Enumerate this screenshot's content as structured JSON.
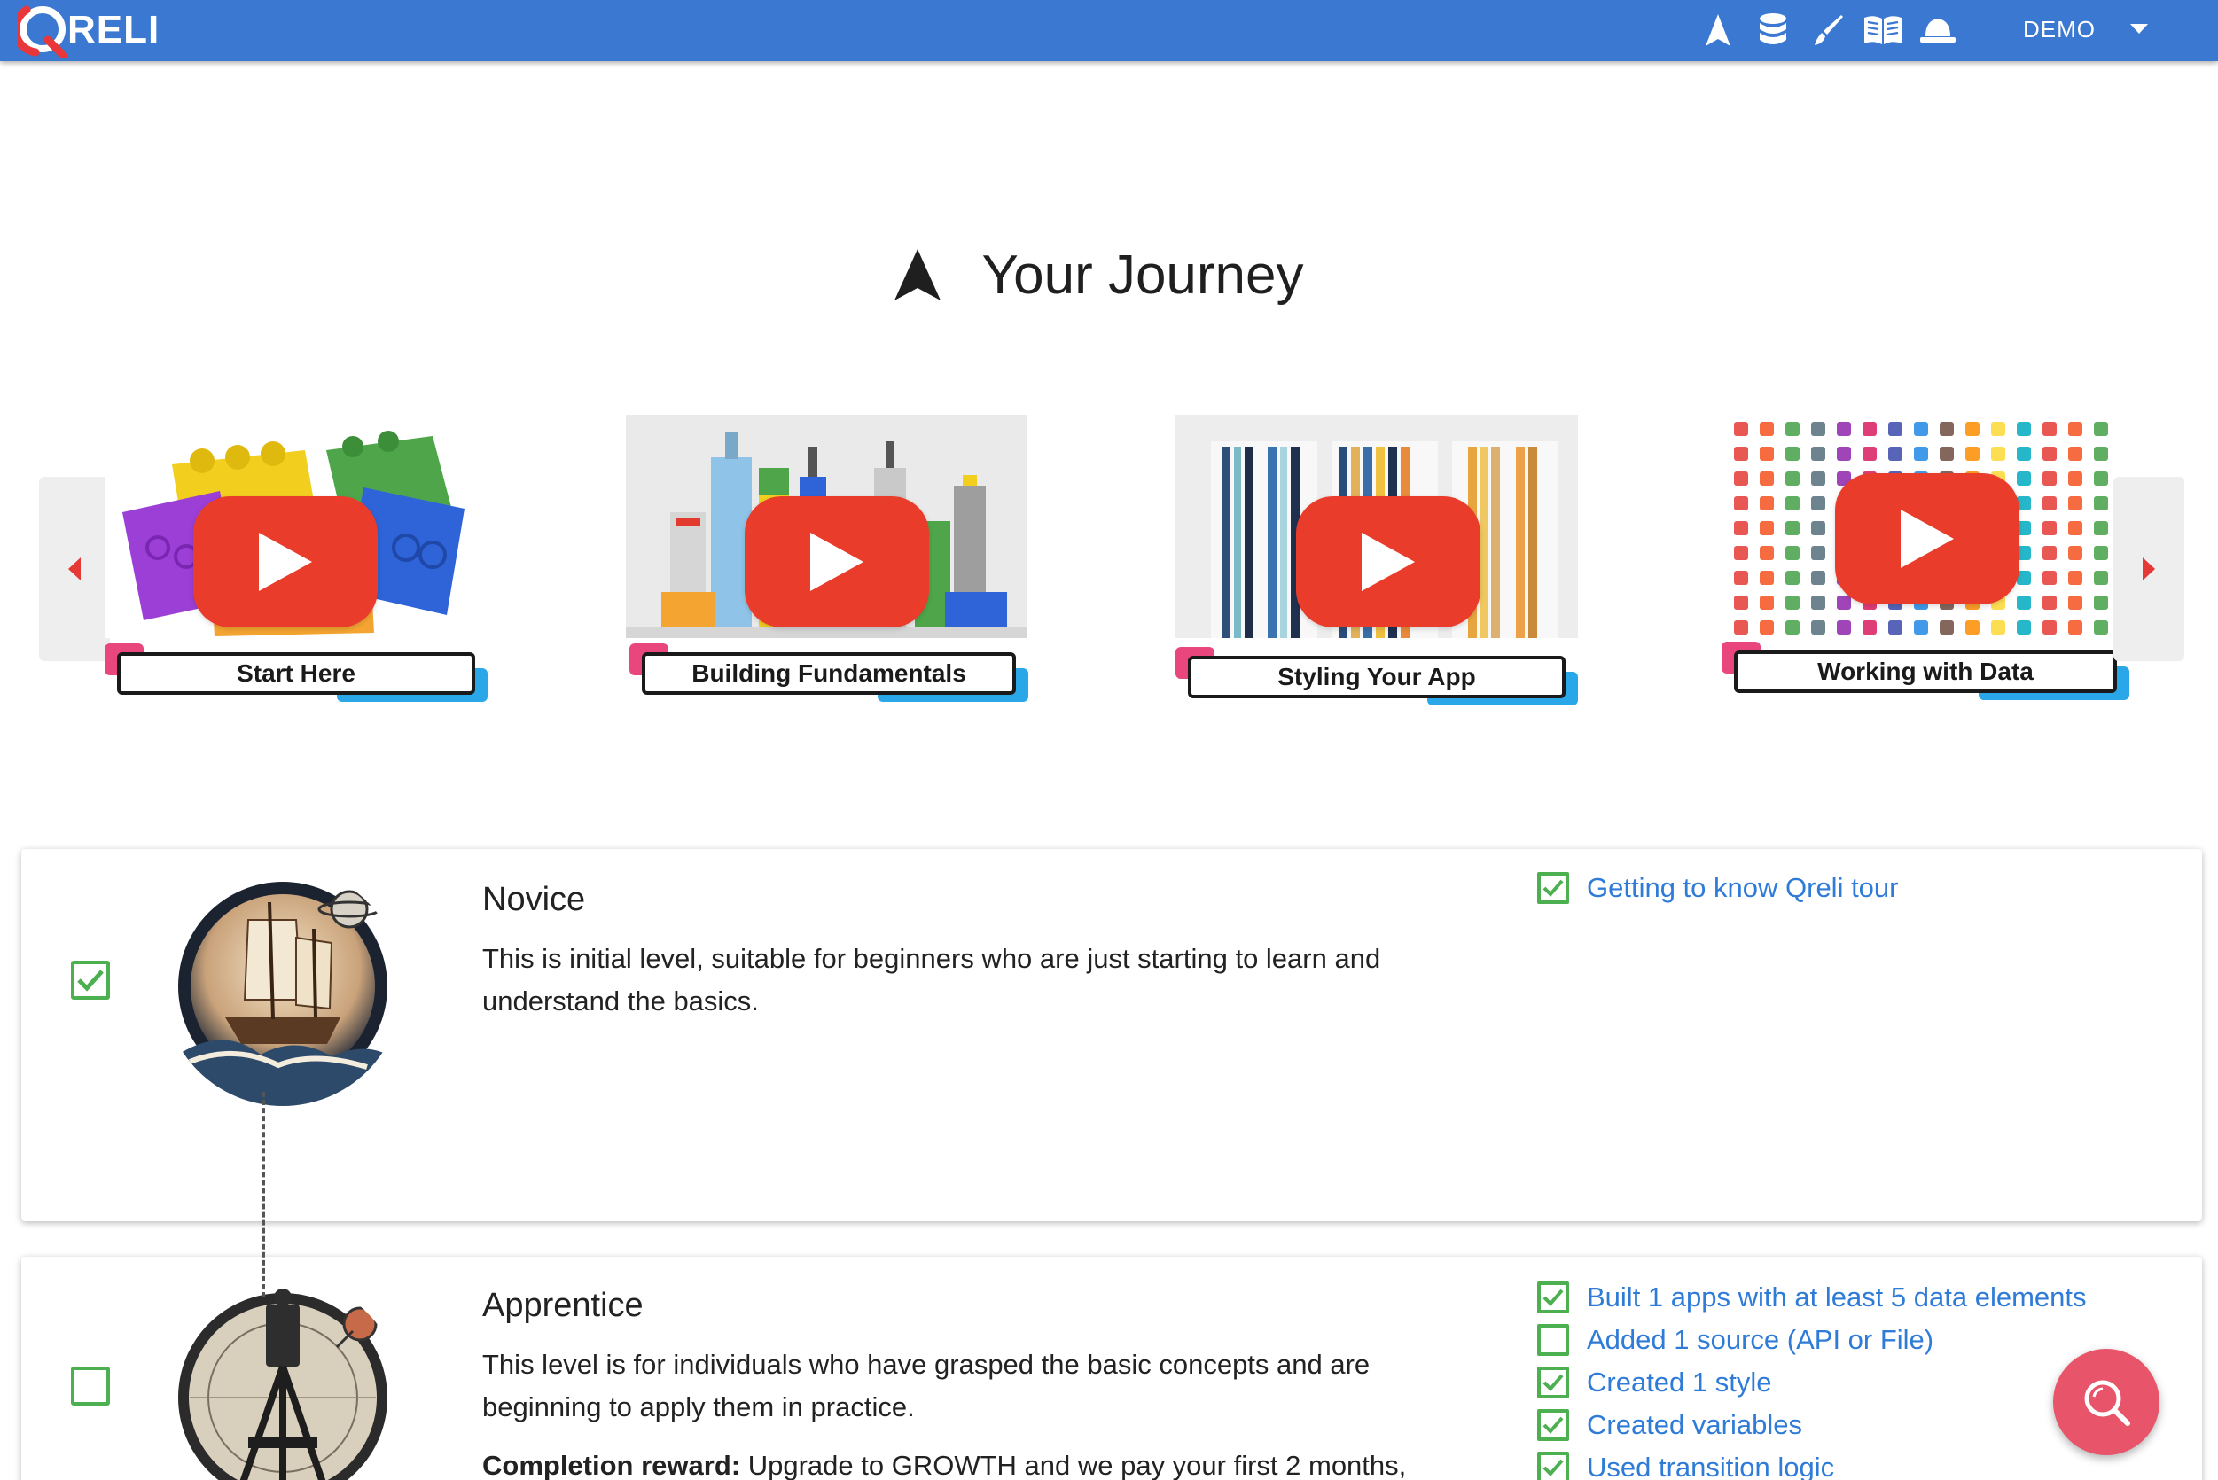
{
  "app": {
    "logo_text": "RELI"
  },
  "topbar": {
    "icons": [
      "journey-icon",
      "database-icon",
      "brush-icon",
      "book-icon",
      "hat-icon"
    ],
    "user_label": "DEMO"
  },
  "page": {
    "title": "Your Journey"
  },
  "carousel": {
    "cards": [
      {
        "label": "Start Here"
      },
      {
        "label": "Building Fundamentals"
      },
      {
        "label": "Styling Your App"
      },
      {
        "label": "Working with Data"
      }
    ]
  },
  "levels": [
    {
      "title": "Novice",
      "description": "This is initial level, suitable for beginners who are just starting to learn and understand the basics.",
      "checked": true,
      "tasks": [
        {
          "label": "Getting to know Qreli tour",
          "done": true
        }
      ]
    },
    {
      "title": "Apprentice",
      "description": "This level is for individuals who have grasped the basic concepts and are beginning to apply them in practice.",
      "checked": false,
      "reward_label": "Completion reward:",
      "reward_text": " Upgrade to GROWTH and we pay your first 2 months,",
      "tasks": [
        {
          "label": "Built 1 apps with at least 5 data elements",
          "done": true
        },
        {
          "label": "Added 1 source (API or File)",
          "done": false
        },
        {
          "label": "Created 1 style",
          "done": true
        },
        {
          "label": "Created variables",
          "done": true
        },
        {
          "label": "Used transition logic",
          "done": true
        }
      ]
    }
  ],
  "colors": {
    "topbar": "#3a78d1",
    "accent_green": "#4caf50",
    "link_blue": "#2f7bd8",
    "fab": "#e8546a",
    "play_red": "#ea3c2b"
  }
}
